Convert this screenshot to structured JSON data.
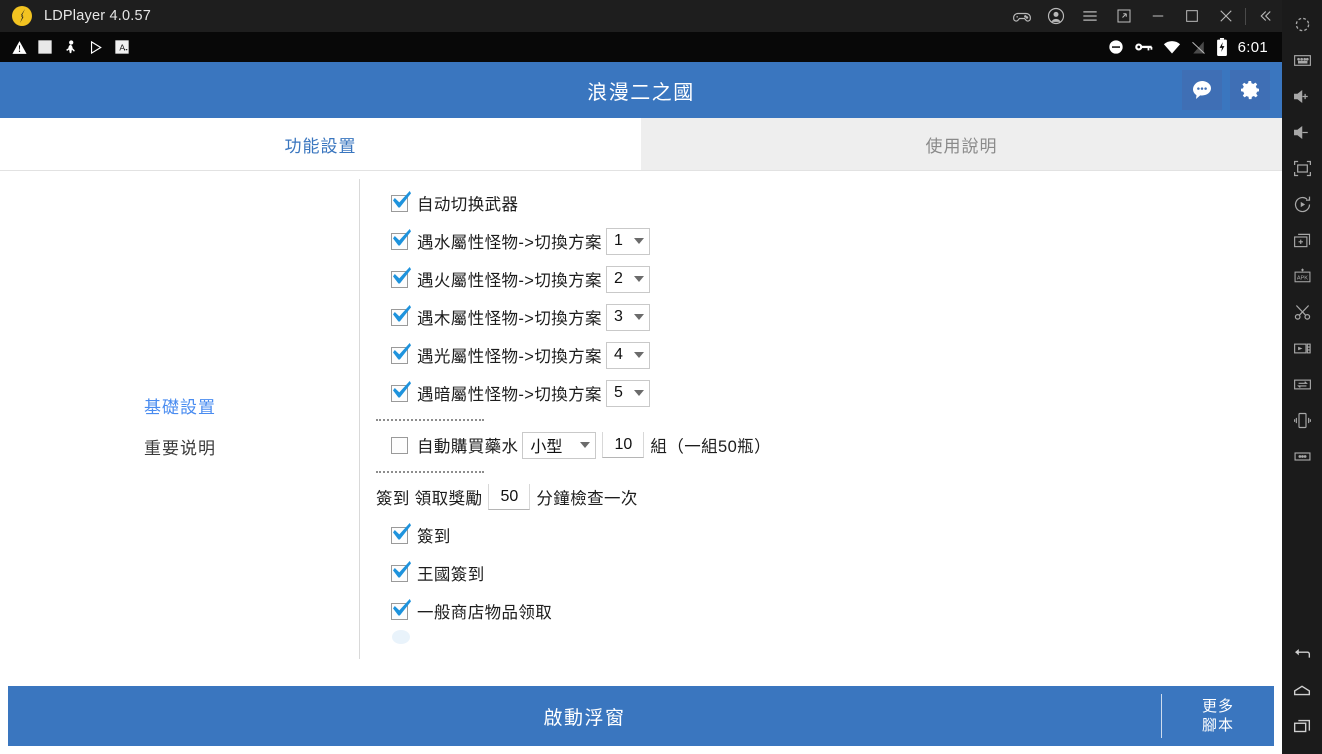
{
  "window": {
    "app_name": "LDPlayer 4.0.57",
    "logo_icon": "ldplayer-logo",
    "controls": [
      {
        "name": "gamepad-icon",
        "label": "Gamepad"
      },
      {
        "name": "account-icon",
        "label": "Account"
      },
      {
        "name": "menu-icon",
        "label": "Menu"
      },
      {
        "name": "resize-icon",
        "label": "Resize"
      },
      {
        "name": "minimize-icon",
        "label": "Minimize"
      },
      {
        "name": "maximize-icon",
        "label": "Maximize"
      },
      {
        "name": "close-icon",
        "label": "Close"
      },
      {
        "name": "collapse-sidebar-icon",
        "label": "Collapse"
      }
    ]
  },
  "statusbar": {
    "left_icons": [
      {
        "name": "warning-icon"
      },
      {
        "name": "blank-app-icon"
      },
      {
        "name": "mascot-app-icon"
      },
      {
        "name": "play-store-icon"
      },
      {
        "name": "letter-a-app-icon"
      }
    ],
    "right_icons": [
      {
        "name": "do-not-disturb-icon"
      },
      {
        "name": "vpn-key-icon"
      },
      {
        "name": "wifi-icon"
      },
      {
        "name": "signal-icon"
      },
      {
        "name": "battery-charging-icon"
      }
    ],
    "time": "6:01"
  },
  "rail": {
    "items": [
      {
        "name": "settings-icon"
      },
      {
        "name": "keyboard-icon"
      },
      {
        "name": "volume-up-icon"
      },
      {
        "name": "volume-down-icon"
      },
      {
        "name": "fullscreen-icon"
      },
      {
        "name": "rotate-icon"
      },
      {
        "name": "add-window-icon"
      },
      {
        "name": "install-apk-icon"
      },
      {
        "name": "screenshot-scissors-icon"
      },
      {
        "name": "record-video-icon"
      },
      {
        "name": "file-transfer-icon"
      },
      {
        "name": "shake-icon"
      },
      {
        "name": "more-icon"
      }
    ],
    "nav": [
      {
        "name": "back-icon"
      },
      {
        "name": "home-icon"
      },
      {
        "name": "recents-icon"
      }
    ]
  },
  "header": {
    "title": "浪漫二之國",
    "chat_icon": "chat-bubble-icon",
    "settings_icon": "gear-icon"
  },
  "tabs": [
    {
      "label": "功能設置",
      "active": true
    },
    {
      "label": "使用說明",
      "active": false
    }
  ],
  "sidebar": {
    "items": [
      {
        "label": "基礎設置",
        "active": true
      },
      {
        "label": "重要说明",
        "active": false
      }
    ]
  },
  "settings": {
    "auto_switch_weapon": {
      "label": "自动切换武器",
      "checked": true
    },
    "element_rules": [
      {
        "label": "遇水屬性怪物->切換方案",
        "checked": true,
        "value": "1"
      },
      {
        "label": "遇火屬性怪物->切換方案",
        "checked": true,
        "value": "2"
      },
      {
        "label": "遇木屬性怪物->切換方案",
        "checked": true,
        "value": "3"
      },
      {
        "label": "遇光屬性怪物->切換方案",
        "checked": true,
        "value": "4"
      },
      {
        "label": "遇暗屬性怪物->切換方案",
        "checked": true,
        "value": "5"
      }
    ],
    "auto_buy_potion": {
      "label": "自動購買藥水",
      "checked": false,
      "size_value": "小型",
      "quantity": "10",
      "unit_label": "組",
      "note": "（一組50瓶）"
    },
    "checkin_interval": {
      "prefix_label": "簽到 領取獎勵",
      "minutes": "50",
      "suffix_label": "分鐘檢查一次"
    },
    "checkin_items": [
      {
        "label": "簽到",
        "checked": true
      },
      {
        "label": "王國簽到",
        "checked": true
      },
      {
        "label": "一般商店物品领取",
        "checked": true
      }
    ]
  },
  "bottom_bar": {
    "primary_label": "啟動浮窗",
    "more_line1": "更多",
    "more_line2": "腳本"
  },
  "colors": {
    "brand_blue": "#3a76bf",
    "accent_link": "#4a8cf0",
    "checkbox_blue": "#1e93dd",
    "titlebar_bg": "#1e1e1e",
    "rail_bg": "#1b1b1b"
  }
}
